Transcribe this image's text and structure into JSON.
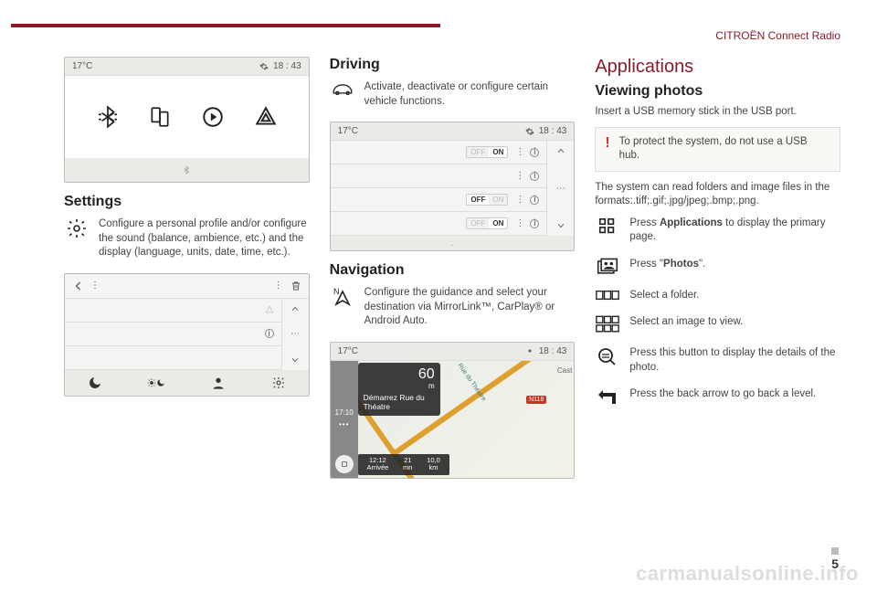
{
  "header": {
    "product": "CITROËN Connect Radio"
  },
  "status": {
    "temp": "17°C",
    "time": "18 : 43"
  },
  "col1": {
    "settings_title": "Settings",
    "settings_desc": "Configure a personal profile and/or configure the sound (balance, ambience, etc.) and the display (language, units, date, time, etc.)."
  },
  "col2": {
    "driving_title": "Driving",
    "driving_desc": "Activate, deactivate or configure certain vehicle functions.",
    "toggle_on": "ON",
    "toggle_off": "OFF",
    "navigation_title": "Navigation",
    "navigation_desc": "Configure the guidance and select your destination via MirrorLink™, CarPlay® or Android Auto.",
    "nav": {
      "distance_value": "60",
      "distance_unit": "m",
      "street": "Démarrez Rue du Théatre",
      "sidebar_time": "17:10",
      "eta_time": "12:12",
      "eta_label": "Arrivée",
      "remain_min": "21",
      "remain_min_label": "mn",
      "remain_km": "10,0",
      "remain_km_label": "km",
      "road_label": "Rue du Théatre",
      "badge": "N118",
      "city": "Cast"
    }
  },
  "col3": {
    "applications_title": "Applications",
    "viewing_title": "Viewing photos",
    "insert_text": "Insert a USB memory stick in the USB port.",
    "alert_text": "To protect the system, do not use a USB hub.",
    "formats_text": "The system can read folders and image files in the formats:.tiff;.gif;.jpg/jpeg;.bmp;.png.",
    "step_apps_pre": "Press ",
    "step_apps_bold": "Applications",
    "step_apps_post": " to display the primary page.",
    "step_photos_pre": "Press \"",
    "step_photos_bold": "Photos",
    "step_photos_post": "\".",
    "step_folder": "Select a folder.",
    "step_image": "Select an image to view.",
    "step_details": "Press this button to display the details of the photo.",
    "step_back": "Press the back arrow to go back a level."
  },
  "page_number": "5"
}
